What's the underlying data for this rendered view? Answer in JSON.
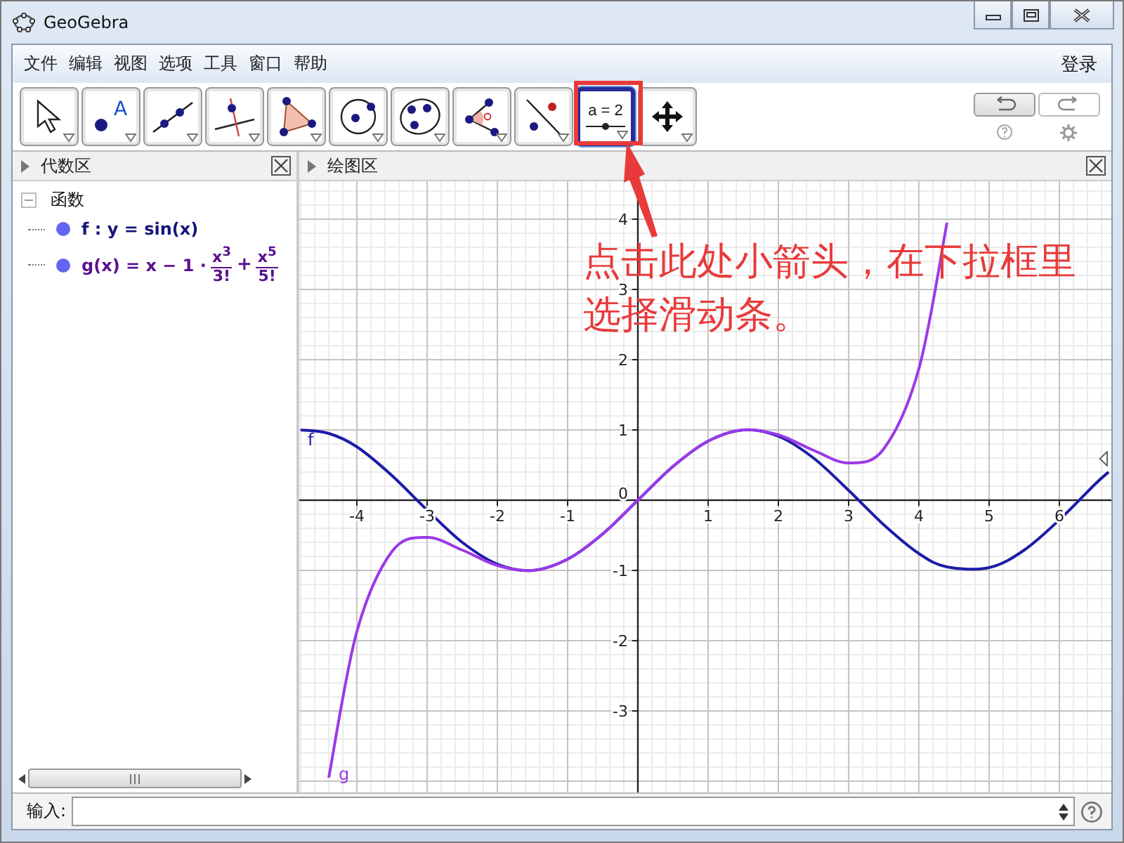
{
  "window": {
    "title": "GeoGebra"
  },
  "menu": {
    "items": [
      "文件",
      "编辑",
      "视图",
      "选项",
      "工具",
      "窗口",
      "帮助"
    ],
    "login": "登录"
  },
  "toolbar": {
    "tools": [
      {
        "kind": "move",
        "selected": false
      },
      {
        "kind": "point",
        "selected": false,
        "label": "A"
      },
      {
        "kind": "line",
        "selected": false
      },
      {
        "kind": "perpendicular",
        "selected": false
      },
      {
        "kind": "polygon",
        "selected": false
      },
      {
        "kind": "circle",
        "selected": false
      },
      {
        "kind": "conic",
        "selected": false
      },
      {
        "kind": "angle",
        "selected": false
      },
      {
        "kind": "reflect",
        "selected": false
      },
      {
        "kind": "slider",
        "selected": true,
        "label": "a = 2"
      },
      {
        "kind": "move-view",
        "selected": false
      }
    ]
  },
  "algebra_view": {
    "title": "代数区",
    "group": {
      "label": "函数",
      "expanded": true,
      "children": [
        {
          "kind": "plain",
          "color": "#6464f0",
          "formula": "f : y = sin(x)"
        },
        {
          "kind": "fraction",
          "color": "#6464f0",
          "lead": "g(x) = x − 1 ·",
          "terms": [
            {
              "num": "x$^{3}$",
              "den": "3!"
            },
            {
              "sign": "+",
              "num": "x$^{5}$",
              "den": "5!"
            }
          ]
        }
      ]
    }
  },
  "graphics_view": {
    "title": "绘图区",
    "chart_data": {
      "type": "line",
      "x": [
        -4.8,
        -4.4,
        -4,
        -3.5,
        -3,
        -2.5,
        -2,
        -1.5,
        -1,
        -0.5,
        0,
        0.5,
        1,
        1.5,
        2,
        2.5,
        3,
        3.5,
        4,
        4.4,
        5,
        5.5,
        6,
        6.5,
        6.7
      ],
      "series": [
        {
          "name": "f",
          "color": "#1c1ca8",
          "values": [
            1,
            0.95,
            0.76,
            0.35,
            -0.14,
            -0.6,
            -0.91,
            -1,
            -0.84,
            -0.48,
            0,
            0.48,
            0.84,
            1,
            0.91,
            0.6,
            0.14,
            -0.35,
            -0.76,
            -0.95,
            -0.96,
            -0.71,
            -0.28,
            0.22,
            0.4
          ]
        },
        {
          "name": "g",
          "color": "#9b3ae8",
          "values": [
            null,
            -3.95,
            -1.87,
            -0.73,
            -0.53,
            -0.71,
            -0.93,
            -1,
            -0.84,
            -0.48,
            0,
            0.48,
            0.84,
            1,
            0.93,
            0.71,
            0.53,
            0.73,
            1.87,
            3.95,
            null,
            null,
            null,
            null,
            null
          ]
        }
      ],
      "grid": true,
      "xlim": [
        -4.82,
        6.74
      ],
      "ylim": [
        -4.16,
        4.54
      ],
      "xticks": [
        -4,
        -3,
        -2,
        -1,
        1,
        2,
        3,
        4,
        5,
        6
      ],
      "yticks": [
        -3,
        -2,
        -1,
        0,
        1,
        2,
        3,
        4
      ]
    }
  },
  "input_bar": {
    "label": "输入:"
  },
  "annotation": {
    "lines": [
      "点击此处小箭头，在下拉框里",
      "选择滑动条。"
    ]
  }
}
